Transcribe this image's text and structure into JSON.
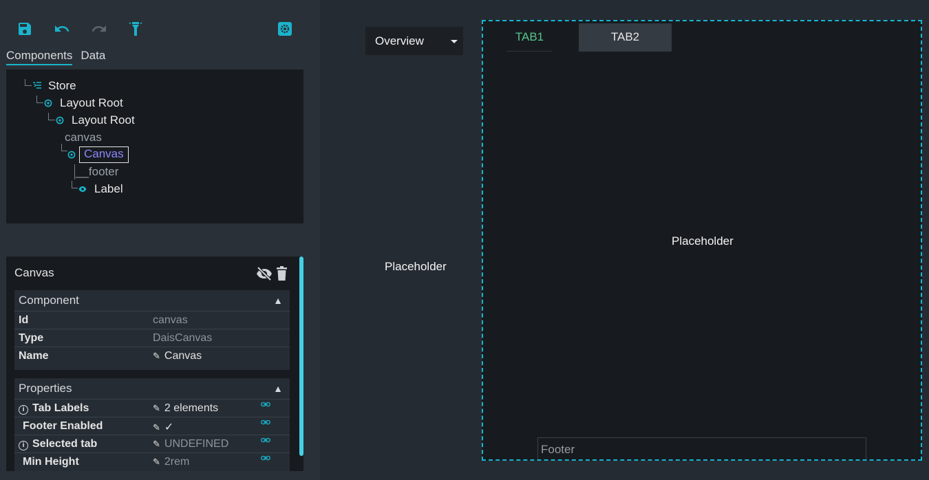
{
  "colors": {
    "accent": "#1ab4cc",
    "selected_text": "#8e86ff",
    "tab_active_text": "#56c58e",
    "dashed_border": "#17b6d2"
  },
  "toolbar": {
    "save_icon": "save-icon",
    "undo_icon": "undo-icon",
    "redo_icon": "redo-icon",
    "highlight_icon": "flashlight-icon",
    "settings_icon": "settings-icon"
  },
  "panel_tabs": [
    {
      "label": "Components",
      "active": true
    },
    {
      "label": "Data",
      "active": false
    }
  ],
  "tree": {
    "store": "Store",
    "layout_root_1": "Layout Root",
    "layout_root_2": "Layout Root",
    "canvas_slot": "canvas",
    "canvas_selected": "Canvas",
    "footer_slot": "__footer",
    "label": "Label"
  },
  "inspector": {
    "title": "Canvas",
    "component_section": {
      "title": "Component",
      "rows": [
        {
          "key": "Id",
          "value": "canvas"
        },
        {
          "key": "Type",
          "value": "DaisCanvas"
        },
        {
          "key": "Name",
          "value": "Canvas"
        }
      ]
    },
    "properties_section": {
      "title": "Properties",
      "rows": [
        {
          "key": "Tab Labels",
          "value": "2 elements",
          "info": true
        },
        {
          "key": "Footer Enabled",
          "value": "✓",
          "info": false
        },
        {
          "key": "Selected tab",
          "value": "UNDEFINED",
          "info": true
        },
        {
          "key": "Min Height",
          "value": "2rem",
          "info": false
        }
      ]
    }
  },
  "preview": {
    "selector_label": "Overview",
    "left_placeholder": "Placeholder",
    "canvas_tabs": [
      {
        "label": "TAB1"
      },
      {
        "label": "TAB2"
      }
    ],
    "canvas_placeholder": "Placeholder",
    "footer_label": "Footer"
  }
}
